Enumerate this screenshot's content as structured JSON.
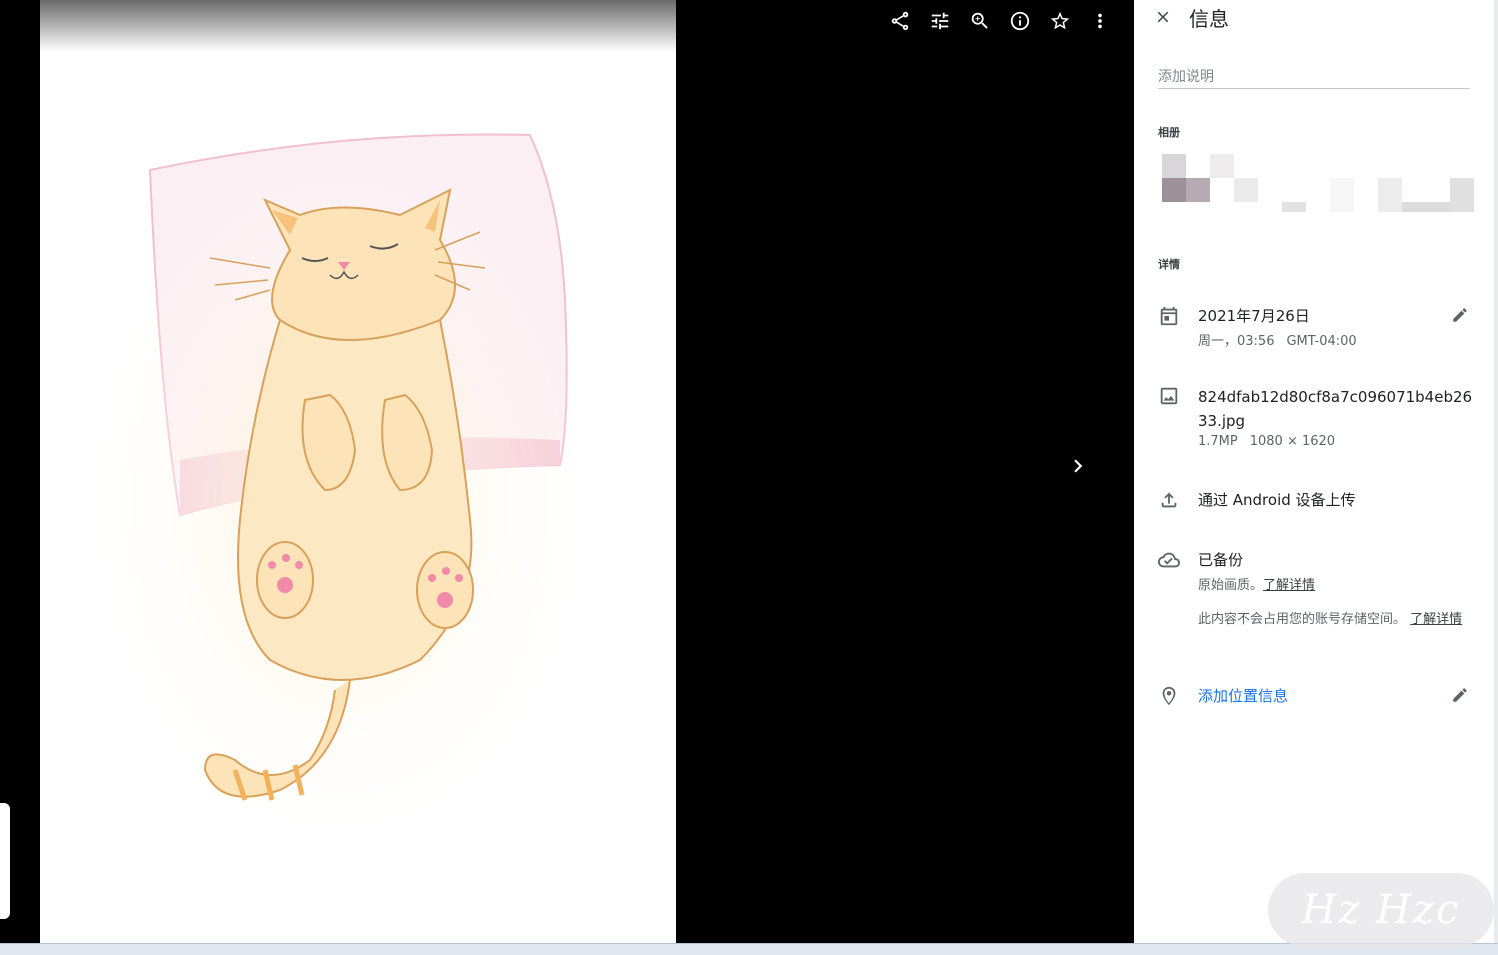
{
  "toolbar": {
    "icons": [
      "share-icon",
      "tune-icon",
      "zoom-in-icon",
      "info-icon",
      "star-icon",
      "more-vert-icon"
    ]
  },
  "viewer": {
    "next_icon": "chevron-right-icon"
  },
  "panel": {
    "title": "信息",
    "caption_placeholder": "添加说明",
    "albums_label": "相册",
    "details_label": "详情",
    "date": {
      "main": "2021年7月26日",
      "day_time": "周一，03:56",
      "timezone": "GMT-04:00"
    },
    "file": {
      "name": "824dfab12d80cf8a7c096071b4eb2633.jpg",
      "size": "1.7MP",
      "dimensions": "1080 × 1620"
    },
    "upload": {
      "text": "通过 Android 设备上传"
    },
    "backup": {
      "title": "已备份",
      "quality": "原始画质。",
      "quality_link": "了解详情",
      "storage": "此内容不会占用您的账号存储空间。",
      "storage_link": "了解详情"
    },
    "location": {
      "text": "添加位置信息"
    }
  },
  "watermark": "Hz Hzc",
  "colors": {
    "link_blue": "#1a73e8",
    "viewer_bg": "#000000",
    "panel_bg": "#ffffff"
  }
}
